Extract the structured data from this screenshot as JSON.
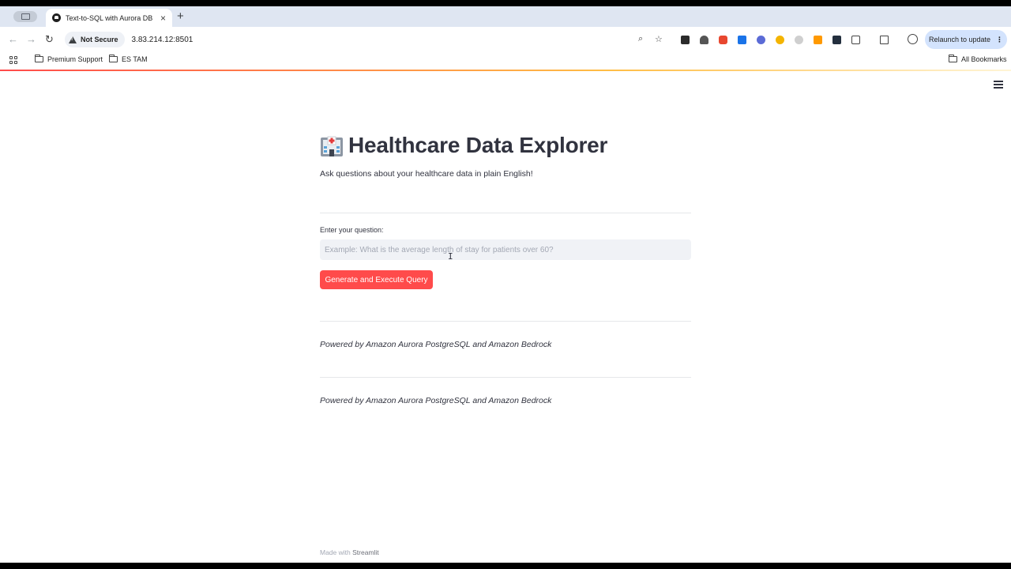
{
  "browser": {
    "tab_title": "Text-to-SQL with Aurora DB",
    "security_label": "Not Secure",
    "url": "3.83.214.12:8501",
    "relaunch_label": "Relaunch to update",
    "bookmarks": [
      "Premium Support",
      "ES TAM"
    ],
    "all_bookmarks_label": "All Bookmarks"
  },
  "app": {
    "title": "Healthcare Data Explorer",
    "subtitle": "Ask questions about your healthcare data in plain English!",
    "question_label": "Enter your question:",
    "question_placeholder": "Example: What is the average length of stay for patients over 60?",
    "question_value": "",
    "run_button_label": "Generate and Execute Query",
    "footer_notes": [
      "Powered by Amazon Aurora PostgreSQL and Amazon Bedrock",
      "Powered by Amazon Aurora PostgreSQL and Amazon Bedrock"
    ],
    "made_with_prefix": "Made with",
    "made_with_brand": "Streamlit"
  },
  "colors": {
    "accent": "#ff4b4b",
    "text": "#31333f",
    "input_bg": "#f0f2f6",
    "relaunch_bg": "#d3e3fd"
  },
  "icons": [
    "back-icon",
    "forward-icon",
    "reload-icon",
    "warning-icon",
    "zoom-icon",
    "star-icon",
    "apps-icon",
    "folder-icon",
    "hospital-icon",
    "hamburger-menu-icon",
    "profile-icon",
    "kebab-menu-icon"
  ]
}
